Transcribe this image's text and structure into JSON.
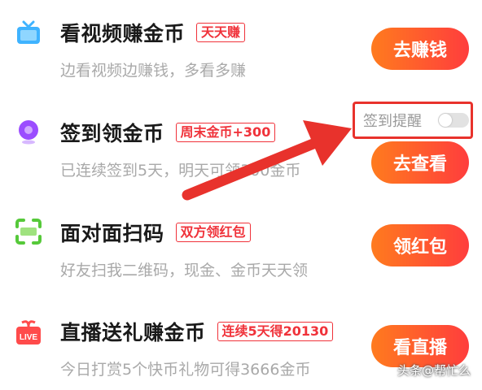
{
  "tasks": [
    {
      "icon": "tv-icon",
      "title": "看视频赚金币",
      "badge": "天天赚",
      "description": "边看视频边赚钱，多看多赚",
      "button": "去赚钱"
    },
    {
      "icon": "location-pin-icon",
      "title": "签到领金币",
      "badge": "周末金币+300",
      "description": "已连续签到5天，明天可领300金币",
      "button": "去查看"
    },
    {
      "icon": "scan-icon",
      "title": "面对面扫码",
      "badge": "双方领红包",
      "description": "好友扫我二维码，现金、金币天天领",
      "button": "领红包"
    },
    {
      "icon": "live-gift-icon",
      "title": "直播送礼赚金币",
      "badge": "连续5天得20130",
      "description": "今日打赏5个快币礼物可得3666金币",
      "button": "看直播"
    }
  ],
  "reminder": {
    "label": "签到提醒",
    "enabled": false
  },
  "watermark": "头条@帮忙么",
  "colors": {
    "accent_red": "#f0323a",
    "button_gradient_start": "#ff7b1e",
    "button_gradient_end": "#ff3d3d",
    "annotation_red": "#e8322c"
  }
}
